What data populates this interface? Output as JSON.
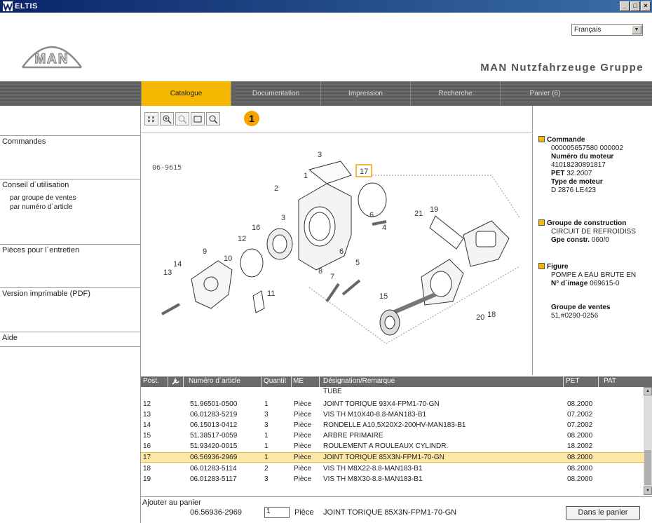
{
  "window": {
    "title": "ELTIS"
  },
  "header": {
    "language": "Français",
    "logo_text": "MAN",
    "group_name": "MAN Nutzfahrzeuge Gruppe"
  },
  "nav": {
    "tabs": [
      "Catalogue",
      "Documentation",
      "Impression",
      "Recherche",
      "Panier (6)"
    ],
    "active": "Catalogue"
  },
  "sidebar": {
    "commandes": "Commandes",
    "conseil": "Conseil d´utilisation",
    "par_groupe": "par groupe de ventes",
    "par_numero": "par numéro d´article",
    "pieces": "Pièces pour l´entretien",
    "version": "Version imprimable (PDF)",
    "aide": "Aide"
  },
  "viewer": {
    "callout": "1",
    "figure_number": "06-9615",
    "labels": [
      "1",
      "2",
      "3",
      "3",
      "4",
      "5",
      "6",
      "6",
      "7",
      "8",
      "9",
      "10",
      "11",
      "12",
      "13",
      "14",
      "15",
      "16",
      "17",
      "18",
      "19",
      "20",
      "21"
    ],
    "highlighted_label": "17"
  },
  "info": {
    "commande_label": "Commande",
    "commande_value": "000005657580 000002",
    "numero_moteur_label": "Numéro du moteur",
    "numero_moteur_value": "41018230891817",
    "pet_label": "PET",
    "pet_value": "32.2007",
    "type_moteur_label": "Type de moteur",
    "type_moteur_value": "D 2876 LE423",
    "groupe_construction_label": "Groupe de construction",
    "groupe_construction_value": "CIRCUIT DE REFROIDISS",
    "gpe_constr_label": "Gpe constr.",
    "gpe_constr_value": "060/0",
    "figure_label": "Figure",
    "figure_value": "POMPE A EAU BRUTE EN",
    "no_image_label": "N° d´image",
    "no_image_value": "069615-0",
    "groupe_ventes_label": "Groupe de ventes",
    "groupe_ventes_value": "51.#0290-0256"
  },
  "table": {
    "headers": [
      "Post.",
      "Numéro d´article",
      "Quantit",
      "ME",
      "Désignation/Remarque",
      "PET",
      "PAT"
    ],
    "partial_top": "TUBE",
    "rows": [
      {
        "post": "12",
        "num": "51.96501-0500",
        "qty": "1",
        "me": "Pièce",
        "desc": "JOINT TORIQUE 93X4-FPM1-70-GN",
        "pet": "08.2000"
      },
      {
        "post": "13",
        "num": "06.01283-5219",
        "qty": "3",
        "me": "Pièce",
        "desc": "VIS TH M10X40-8.8-MAN183-B1",
        "pet": "07.2002"
      },
      {
        "post": "14",
        "num": "06.15013-0412",
        "qty": "3",
        "me": "Pièce",
        "desc": "RONDELLE A10,5X20X2-200HV-MAN183-B1",
        "pet": "07.2002"
      },
      {
        "post": "15",
        "num": "51.38517-0059",
        "qty": "1",
        "me": "Pièce",
        "desc": "ARBRE PRIMAIRE",
        "pet": "08.2000"
      },
      {
        "post": "16",
        "num": "51.93420-0015",
        "qty": "1",
        "me": "Pièce",
        "desc": "ROULEMENT A ROULEAUX CYLINDR.",
        "pet": "18.2002"
      },
      {
        "post": "17",
        "num": "06.56936-2969",
        "qty": "1",
        "me": "Pièce",
        "desc": "JOINT TORIQUE 85X3N-FPM1-70-GN",
        "pet": "08.2000",
        "selected": true
      },
      {
        "post": "18",
        "num": "06.01283-5114",
        "qty": "2",
        "me": "Pièce",
        "desc": "VIS TH M8X22-8.8-MAN183-B1",
        "pet": "08.2000"
      },
      {
        "post": "19",
        "num": "06.01283-5117",
        "qty": "3",
        "me": "Pièce",
        "desc": "VIS TH M8X30-8.8-MAN183-B1",
        "pet": "08.2000"
      }
    ]
  },
  "footer": {
    "label": "Ajouter au panier",
    "part_number": "06.56936-2969",
    "quantity": "1",
    "unit": "Pièce",
    "description": "JOINT TORIQUE 85X3N-FPM1-70-GN",
    "button": "Dans le panier"
  },
  "colors": {
    "accent": "#f5b800",
    "nav_bg": "#606060",
    "title_bar": "#0a246a"
  }
}
